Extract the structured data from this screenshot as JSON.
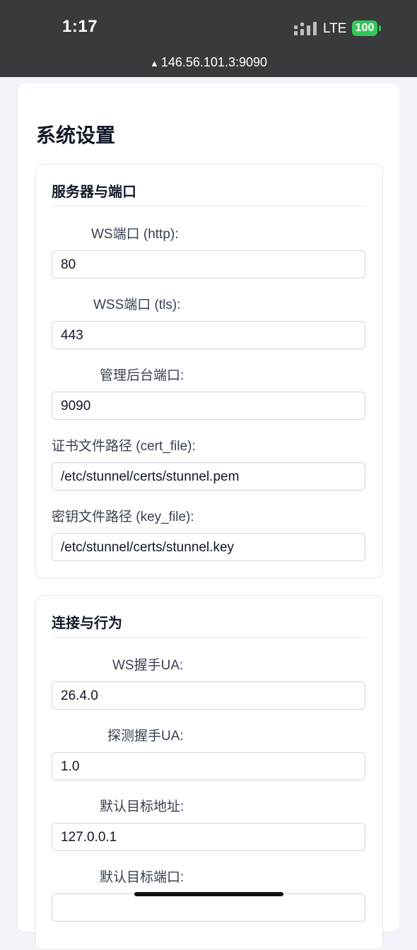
{
  "status_bar": {
    "time": "1:17",
    "network": "LTE",
    "battery": "100",
    "url": "146.56.101.3:9090",
    "url_icon": "warning-icon"
  },
  "page": {
    "title": "系统设置"
  },
  "sections": [
    {
      "title": "服务器与端口",
      "fields": [
        {
          "label": "WS端口 (http):",
          "value": "80"
        },
        {
          "label": "WSS端口 (tls):",
          "value": "443"
        },
        {
          "label": "管理后台端口:",
          "value": "9090"
        },
        {
          "label": "证书文件路径 (cert_file):",
          "value": "/etc/stunnel/certs/stunnel.pem"
        },
        {
          "label": "密钥文件路径 (key_file):",
          "value": "/etc/stunnel/certs/stunnel.key"
        }
      ]
    },
    {
      "title": "连接与行为",
      "fields": [
        {
          "label": "WS握手UA:",
          "value": "26.4.0"
        },
        {
          "label": "探测握手UA:",
          "value": "1.0"
        },
        {
          "label": "默认目标地址:",
          "value": "127.0.0.1"
        },
        {
          "label": "默认目标端口:",
          "value": ""
        }
      ]
    }
  ],
  "colors": {
    "status_bar_bg": "#383a3d",
    "battery": "#33c759",
    "page_bg": "#f1f5f9"
  }
}
